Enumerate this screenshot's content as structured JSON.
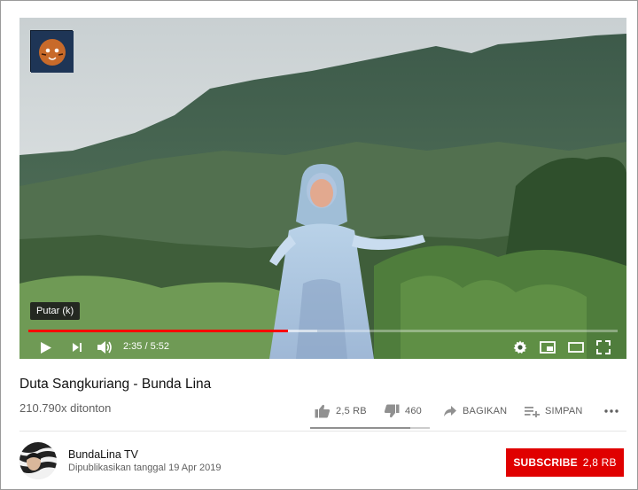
{
  "player": {
    "tooltip": "Putar (k)",
    "time_current": "2:35",
    "time_separator": " / ",
    "time_total": "5:52",
    "progress_fraction": 0.44,
    "buffer_fraction": 0.49,
    "accent_color": "#ff0000",
    "icons": [
      "play-icon",
      "next-icon",
      "volume-icon",
      "settings-icon",
      "miniplayer-icon",
      "theater-icon",
      "fullscreen-icon"
    ]
  },
  "video": {
    "title": "Duta Sangkuriang - Bunda Lina",
    "views": "210.790x ditonton"
  },
  "actions": {
    "like_count": "2,5 RB",
    "dislike_count": "460",
    "share_label": "BAGIKAN",
    "save_label": "SIMPAN",
    "like_fraction": 0.84
  },
  "channel": {
    "name": "BundaLina TV",
    "published": "Dipublikasikan tanggal 19 Apr 2019",
    "subscribe_label": "SUBSCRIBE",
    "subscriber_count": "2,8 RB",
    "subscribe_color": "#e00000"
  }
}
